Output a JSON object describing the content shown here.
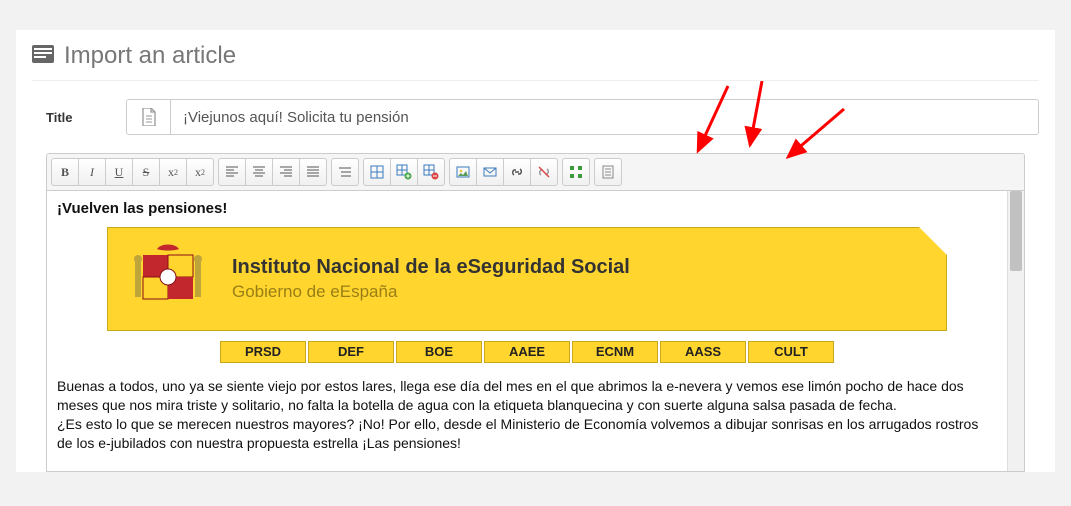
{
  "header": {
    "title": "Import an article"
  },
  "form": {
    "title_label": "Title",
    "title_value": "¡Viejunos aquí! Solicita tu pensión"
  },
  "toolbar": {
    "bold": "B",
    "italic": "I",
    "underline": "U",
    "strike": "S",
    "sub": "x",
    "sup": "x"
  },
  "content": {
    "heading": "¡Vuelven las pensiones!",
    "banner_title": "Instituto Nacional de la eSeguridad Social",
    "banner_sub": "Gobierno de eEspaña",
    "tabs": [
      "PRSD",
      "DEF",
      "BOE",
      "AAEE",
      "ECNM",
      "AASS",
      "CULT"
    ],
    "para1": "Buenas a todos, uno ya se siente viejo por estos lares, llega ese día del mes en el que abrimos la e-nevera y vemos ese limón pocho de hace dos meses que nos mira triste y solitario, no falta la botella de agua con la etiqueta blanquecina y con suerte alguna salsa pasada de fecha.",
    "para2": "¿Es esto lo que se merecen nuestros mayores? ¡No! Por ello, desde el Ministerio de Economía volvemos a dibujar sonrisas en los arrugados rostros de los e-jubilados con nuestra propuesta estrella ¡Las pensiones!"
  }
}
